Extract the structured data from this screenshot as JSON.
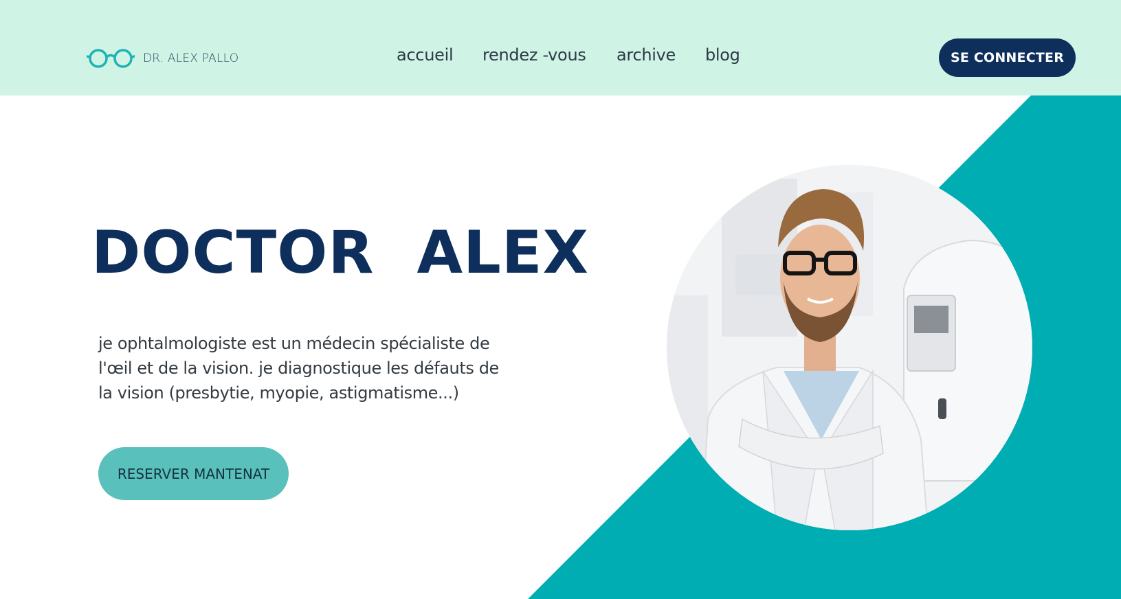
{
  "header": {
    "brand": "DR. ALEX PALLO",
    "logo_icon": "glasses-icon",
    "nav": [
      {
        "label": "accueil"
      },
      {
        "label": "rendez -vous"
      },
      {
        "label": "archive"
      },
      {
        "label": "blog"
      }
    ],
    "login_label": "SE CONNECTER"
  },
  "hero": {
    "title": "DOCTOR  ALEX",
    "description": "je ophtalmologiste est un médecin spécialiste de l'œil et de la vision. je diagnostique les défauts de la vision (presbytie, myopie, astigmatisme...)",
    "cta_label": "RESERVER MANTENAT"
  },
  "colors": {
    "header_bg": "#cff4e6",
    "navy": "#0e2f5c",
    "teal": "#00adb2",
    "cta": "#5ac0bb"
  }
}
